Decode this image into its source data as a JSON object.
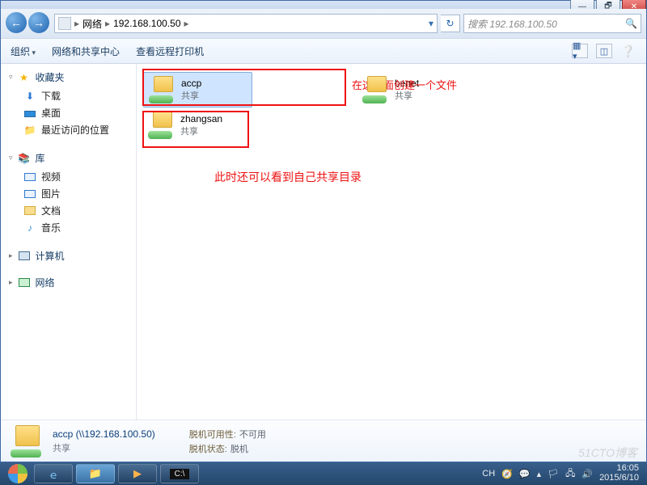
{
  "caption": {
    "min": "—",
    "max": "🗗",
    "close": "✕"
  },
  "breadcrumb": {
    "root": "网络",
    "host": "192.168.100.50"
  },
  "search": {
    "placeholder": "搜索 192.168.100.50"
  },
  "toolbar": {
    "org": "组织",
    "netcenter": "网络和共享中心",
    "remoteprint": "查看远程打印机"
  },
  "sidebar": {
    "fav": {
      "label": "收藏夹",
      "items": [
        "下载",
        "桌面",
        "最近访问的位置"
      ]
    },
    "lib": {
      "label": "库",
      "items": [
        "视频",
        "图片",
        "文档",
        "音乐"
      ]
    },
    "pc": {
      "label": "计算机"
    },
    "net": {
      "label": "网络"
    }
  },
  "items": [
    {
      "name": "accp",
      "sub": "共享"
    },
    {
      "name": "benet",
      "sub": "共享"
    },
    {
      "name": "zhangsan",
      "sub": "共享"
    }
  ],
  "annotations": {
    "a1": "在这里面创建一个文件",
    "a2": "此时还可以看到自己共享目录"
  },
  "details": {
    "title": "accp (\\\\192.168.100.50)",
    "sub": "共享",
    "k1": "脱机可用性:",
    "v1": "不可用",
    "k2": "脱机状态:",
    "v2": "脱机"
  },
  "tray": {
    "ime": "CH",
    "time": "16:05",
    "date": "2015/6/10"
  },
  "watermark": "51CTO博客"
}
